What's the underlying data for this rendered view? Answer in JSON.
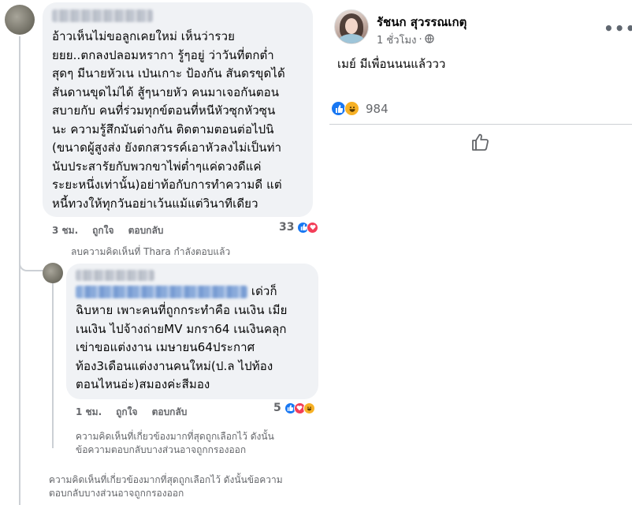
{
  "post": {
    "author": "รัชนก สุวรรณเกตุ",
    "time": "1 ชั่วโมง",
    "text": "เมย์ มีเพื่อนนนแล้ววว",
    "reaction_count": "984",
    "reactions": [
      "like-icon",
      "haha-icon"
    ],
    "privacy_icon": "globe-icon",
    "more_icon": "more-dots-icon",
    "like_button_icon": "thumbs-up-icon"
  },
  "comment1": {
    "text": "อ้าวเห็นไม่ขอลูกเคยใหม่ เห็นว่ารวย\nยยย..ตกลงปลอมหรากา รู้ๆอยู่ ว่าวันที่ตกต่ำ\nสุดๆ มีนายหัวเน เป่นเกาะ ป้องกัน สันดรขุดได้\nสันดานขุดไม่ได้ สู้ๆนายหัว คนมาเจอกันตอน\nสบายกับ คนที่ร่วมทุกข์ตอนที่หนีหัวซุกหัวซุน\nนะ ความรู้สึกมันต่างกัน ติดตามตอนต่อไปนิ\n(ขนาดผู้สูงส่ง ยังตกสวรรค์เอาหัวลงไม่เป็นท่า\nนับประสารัยกับพวกขาไพ่ต่ำๆแค่ดวงดีแค่\nระยะหนึ่งเท่านั้น)อย่าท้อกับการทำความดี แต่\nหนี้ทวงให้ทุกวันอย่าเว้นแม้แต่วินาทีเดียว",
    "time": "3 ชม.",
    "like_label": "ถูกใจ",
    "reply_label": "ตอบกลับ",
    "reaction_count": "33"
  },
  "reply_indicator": "ลบความคิดเห็นที่ Thara กำลังตอบแล้ว",
  "comment2": {
    "first_line_suffix": " เด่วก็",
    "text": "ฉิบหาย เพาะคนที่ถูกกระทำคือ เนเงิน เมีย\nเนเงิน ไปจ้างถ่ายMV มกรา64 เนเงินคลุก\nเข่าขอแต่งงาน เมษายน64ประกาศ\nท้อง3เดือนแต่งงานคนใหม่(ป.ล ไปท้อง\nตอนไหนอ่ะ)สมองค่ะสีมอง",
    "time": "1 ชม.",
    "like_label": "ถูกใจ",
    "reply_label": "ตอบกลับ",
    "reaction_count": "5"
  },
  "note_inner": "ความคิดเห็นที่เกี่ยวข้องมากที่สุดถูกเลือกไว้ ดังนั้น\nข้อความตอบกลับบางส่วนอาจถูกกรองออก",
  "note_outer": "ความคิดเห็นที่เกี่ยวข้องมากที่สุดถูกเลือกไว้ ดังนั้นข้อความ\nตอบกลับบางส่วนอาจถูกกรองออก",
  "colors": {
    "bubble": "#f0f2f5",
    "meta_text": "#65676b",
    "like_blue": "#1877f2",
    "love_red": "#f33e58",
    "haha_yellow": "#f7b125"
  }
}
